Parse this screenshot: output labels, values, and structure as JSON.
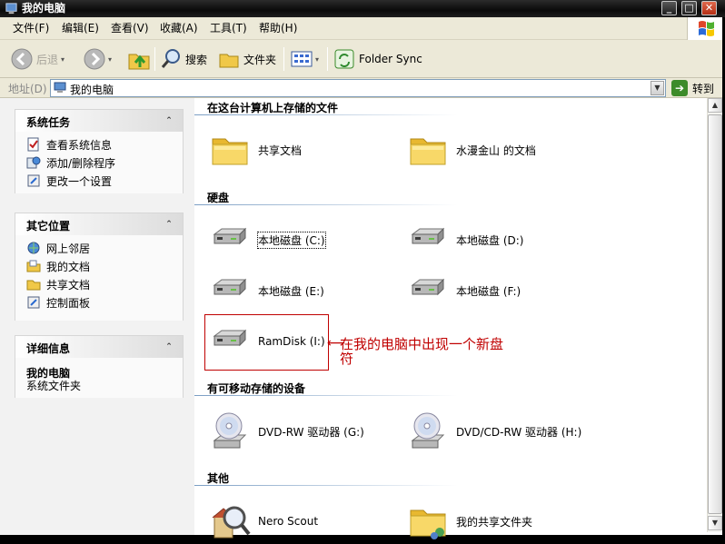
{
  "window": {
    "title": "我的电脑",
    "buttons": {
      "minimize": "_",
      "maximize": "□",
      "close": "✕"
    }
  },
  "menu": {
    "items": [
      "文件(F)",
      "编辑(E)",
      "查看(V)",
      "收藏(A)",
      "工具(T)",
      "帮助(H)"
    ]
  },
  "toolbar": {
    "back": "后退",
    "search": "搜索",
    "folders": "文件夹",
    "folder_sync": "Folder Sync"
  },
  "address": {
    "label": "地址(D)",
    "value": "我的电脑",
    "go": "转到"
  },
  "sidebar": {
    "system_tasks": {
      "title": "系统任务",
      "items": [
        "查看系统信息",
        "添加/删除程序",
        "更改一个设置"
      ]
    },
    "other_places": {
      "title": "其它位置",
      "items": [
        "网上邻居",
        "我的文档",
        "共享文档",
        "控制面板"
      ]
    },
    "details": {
      "title": "详细信息",
      "name": "我的电脑",
      "type": "系统文件夹"
    }
  },
  "groups": {
    "stored_files": {
      "title": "在这台计算机上存储的文件",
      "items": [
        "共享文档",
        "水漫金山 的文档"
      ]
    },
    "hard_disks": {
      "title": "硬盘",
      "items": [
        "本地磁盘 (C:)",
        "本地磁盘 (D:)",
        "本地磁盘 (E:)",
        "本地磁盘 (F:)",
        "RamDisk (I:)"
      ]
    },
    "removable": {
      "title": "有可移动存储的设备",
      "items": [
        "DVD-RW 驱动器 (G:)",
        "DVD/CD-RW 驱动器 (H:)"
      ]
    },
    "other": {
      "title": "其他",
      "items": [
        "Nero Scout",
        "我的共享文件夹"
      ]
    }
  },
  "annotation": {
    "text": "在我的电脑中出现一个新盘符",
    "color": "#c00000"
  },
  "colors": {
    "titlebar": "#0a0a0a",
    "chrome": "#ece9d8",
    "group_line": "#7b9ec4"
  }
}
